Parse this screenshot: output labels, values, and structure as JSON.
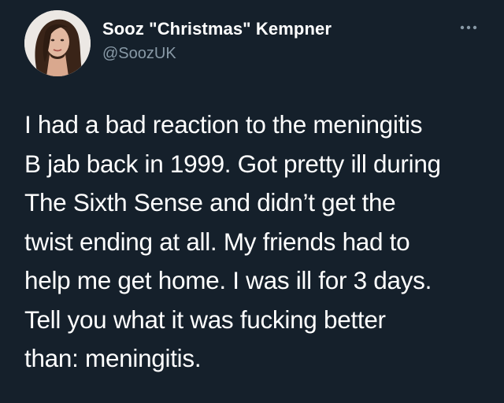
{
  "user": {
    "display_name": "Sooz \"Christmas\" Kempner",
    "handle": "@SoozUK",
    "avatar_icon": "profile-photo"
  },
  "more_icon": "ellipsis-icon",
  "tweet": {
    "lines": [
      "I had a bad reaction to the meningitis",
      "B jab back in 1999. Got pretty ill during",
      "The Sixth Sense and didn’t get the",
      "twist ending at all. My friends had to",
      "help me get home. I was ill for 3 days.",
      "Tell you what it was fucking better",
      "than: meningitis."
    ]
  },
  "colors": {
    "background": "#15202b",
    "text": "#ffffff",
    "secondary_text": "#8899a6"
  }
}
